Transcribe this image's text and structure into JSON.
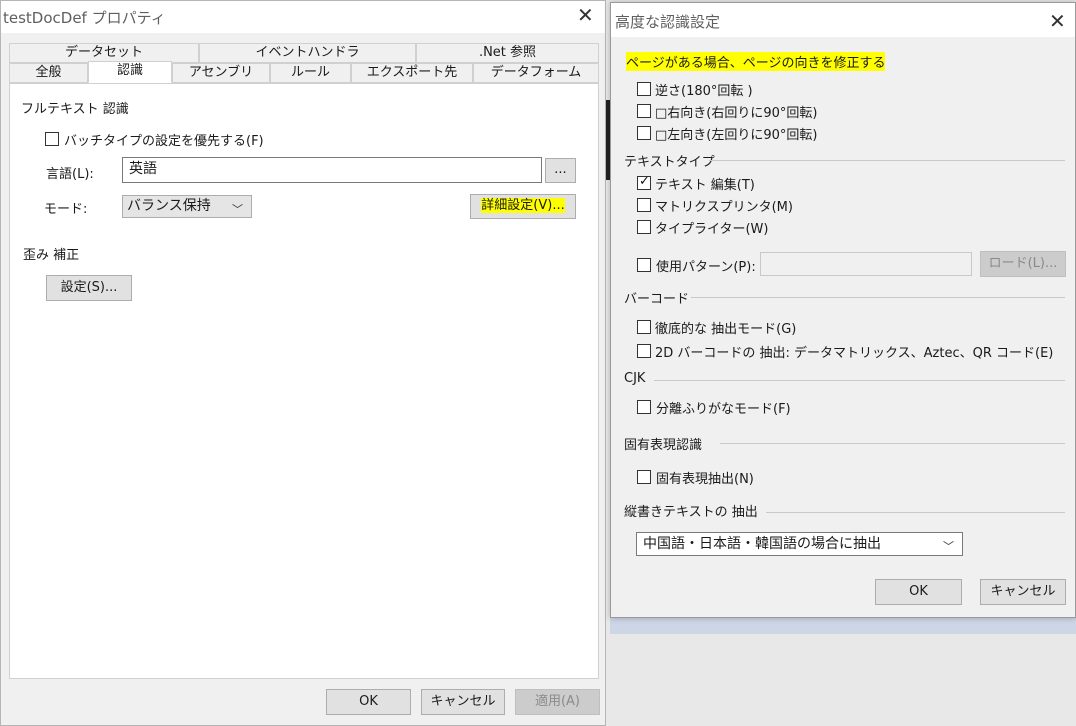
{
  "left_window": {
    "title": "testDocDef プロパティ",
    "tabs_top": [
      ".Net 参照",
      "イベントハンドラ",
      "データセット"
    ],
    "tabs_bottom": [
      "全般",
      "認識",
      "アセンブリ",
      "ルール",
      "エクスポート先",
      "データフォーム"
    ],
    "fulltext_heading": "フルテキスト 認識",
    "batch_checkbox_label": "バッチタイプの設定を優先する(F)",
    "language_label": "言語(L):",
    "language_value": "英語",
    "browse_label": "...",
    "mode_label": "モード:",
    "mode_value": "バランス保持",
    "advanced_button": "詳細設定(V)...",
    "deskew_heading": "歪み 補正",
    "settings_button": "設定(S)...",
    "ok": "OK",
    "cancel": "キャンセル",
    "apply": "適用(A)"
  },
  "right_window": {
    "title": "高度な認識設定",
    "orientation_heading": "ページがある場合、ページの向きを修正する",
    "orientation_options": [
      {
        "label": "逆さ(180°回転 )",
        "checked": false
      },
      {
        "label": "□右向き(右回りに90°回転)",
        "checked": false
      },
      {
        "label": "□左向き(左回りに90°回転)",
        "checked": false
      }
    ],
    "text_type_heading": "テキストタイプ",
    "text_type_options": [
      {
        "label": "テキスト 編集(T)",
        "checked": true
      },
      {
        "label": "マトリクスプリンタ(M)",
        "checked": false
      },
      {
        "label": "タイプライター(W)",
        "checked": false
      }
    ],
    "pattern_label": "使用パターン(P):",
    "pattern_value": "",
    "load_button": "ロード(L)...",
    "barcode_heading": "バーコード",
    "barcode_options": [
      {
        "label": "徹底的な 抽出モード(G)",
        "checked": false
      },
      {
        "label": "2D バーコードの 抽出: データマトリックス、Aztec、QR コード(E)",
        "checked": false
      }
    ],
    "cjk_heading": "CJK",
    "cjk_option": "分離ふりがなモード(F)",
    "ner_heading": "固有表現認識",
    "ner_option": "固有表現抽出(N)",
    "vertical_heading": "縦書きテキストの 抽出",
    "vertical_value": "中国語・日本語・韓国語の場合に抽出",
    "ok": "OK",
    "cancel": "キャンセル"
  },
  "colors": {
    "highlight": "#ffff00",
    "window_bg": "#f0f0f0",
    "panel_bg": "#ffffff"
  }
}
